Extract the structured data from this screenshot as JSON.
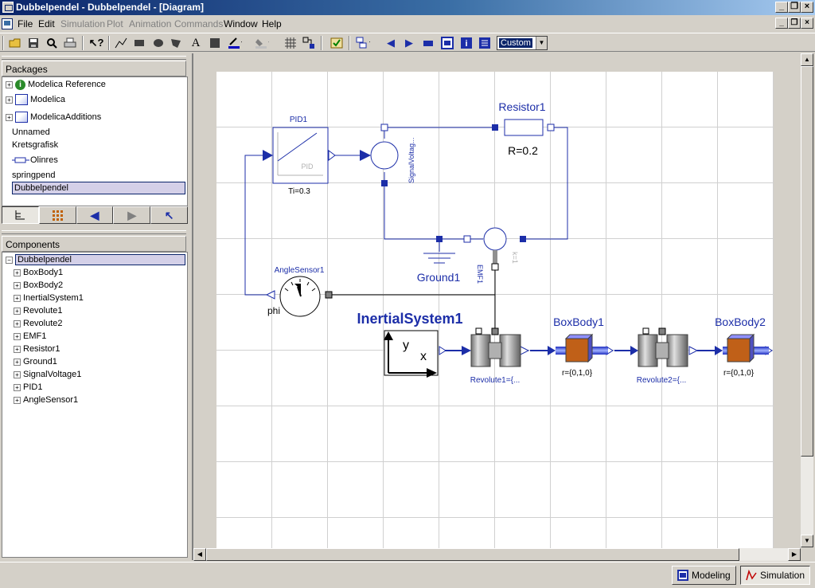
{
  "window": {
    "title": "Dubbelpendel - Dubbelpendel - [Diagram]"
  },
  "menu": [
    {
      "label": "File",
      "enabled": true
    },
    {
      "label": "Edit",
      "enabled": true
    },
    {
      "label": "Simulation",
      "enabled": false
    },
    {
      "label": "Plot",
      "enabled": false
    },
    {
      "label": "Animation",
      "enabled": false
    },
    {
      "label": "Commands",
      "enabled": false
    },
    {
      "label": "Window",
      "enabled": true
    },
    {
      "label": "Help",
      "enabled": true
    }
  ],
  "toolbar": {
    "zoom_value": "Custom"
  },
  "packages": {
    "header": "Packages",
    "items": [
      {
        "label": "Modelica Reference",
        "icon": "info-icon",
        "expandable": true
      },
      {
        "label": "Modelica",
        "icon": "package-icon",
        "expandable": true
      },
      {
        "label": "ModelicaAdditions",
        "icon": "package-icon",
        "expandable": true
      },
      {
        "label": "Unnamed",
        "icon": "none",
        "expandable": false
      },
      {
        "label": "Kretsgrafisk",
        "icon": "none",
        "expandable": false
      },
      {
        "label": "Olinres",
        "icon": "resistor-icon",
        "expandable": false
      },
      {
        "label": "springpend",
        "icon": "none",
        "expandable": false
      },
      {
        "label": "Dubbelpendel",
        "icon": "none",
        "expandable": false,
        "selected": true
      }
    ]
  },
  "components": {
    "header": "Components",
    "root": "Dubbelpendel",
    "items": [
      "BoxBody1",
      "BoxBody2",
      "InertialSystem1",
      "Revolute1",
      "Revolute2",
      "EMF1",
      "Resistor1",
      "Ground1",
      "SignalVoltage1",
      "PID1",
      "AngleSensor1"
    ]
  },
  "diagram": {
    "pid_label": "PID1",
    "pid_inner": "PID",
    "pid_param": "Ti=0.3",
    "signal_voltage_label": "SignalVoltag...",
    "resistor_label": "Resistor1",
    "resistor_param": "R=0.2",
    "ground_label": "Ground1",
    "emf_label": "EMF1",
    "emf_param": "k=1",
    "angle_sensor_label": "AngleSensor1",
    "angle_sensor_output": "phi",
    "inertial_label": "InertialSystem1",
    "inertial_axis_y": "y",
    "inertial_axis_x": "x",
    "boxbody1_label": "BoxBody1",
    "boxbody1_param": "r={0,1,0}",
    "boxbody2_label": "BoxBody2",
    "boxbody2_param": "r={0,1,0}",
    "revolute1_label": "Revolute1={...",
    "revolute2_label": "Revolute2={..."
  },
  "status": {
    "modeling": "Modeling",
    "simulation": "Simulation"
  }
}
